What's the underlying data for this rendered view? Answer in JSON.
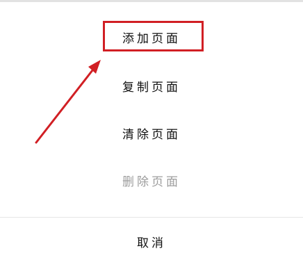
{
  "menu": {
    "items": [
      {
        "label": "添加页面",
        "state": "enabled"
      },
      {
        "label": "复制页面",
        "state": "enabled"
      },
      {
        "label": "清除页面",
        "state": "enabled"
      },
      {
        "label": "删除页面",
        "state": "disabled"
      }
    ]
  },
  "footer": {
    "cancel_label": "取消"
  },
  "colors": {
    "highlight": "#d11f24",
    "text": "#111111",
    "disabled_text": "#9c9c9c",
    "divider": "#e6e6e6"
  }
}
